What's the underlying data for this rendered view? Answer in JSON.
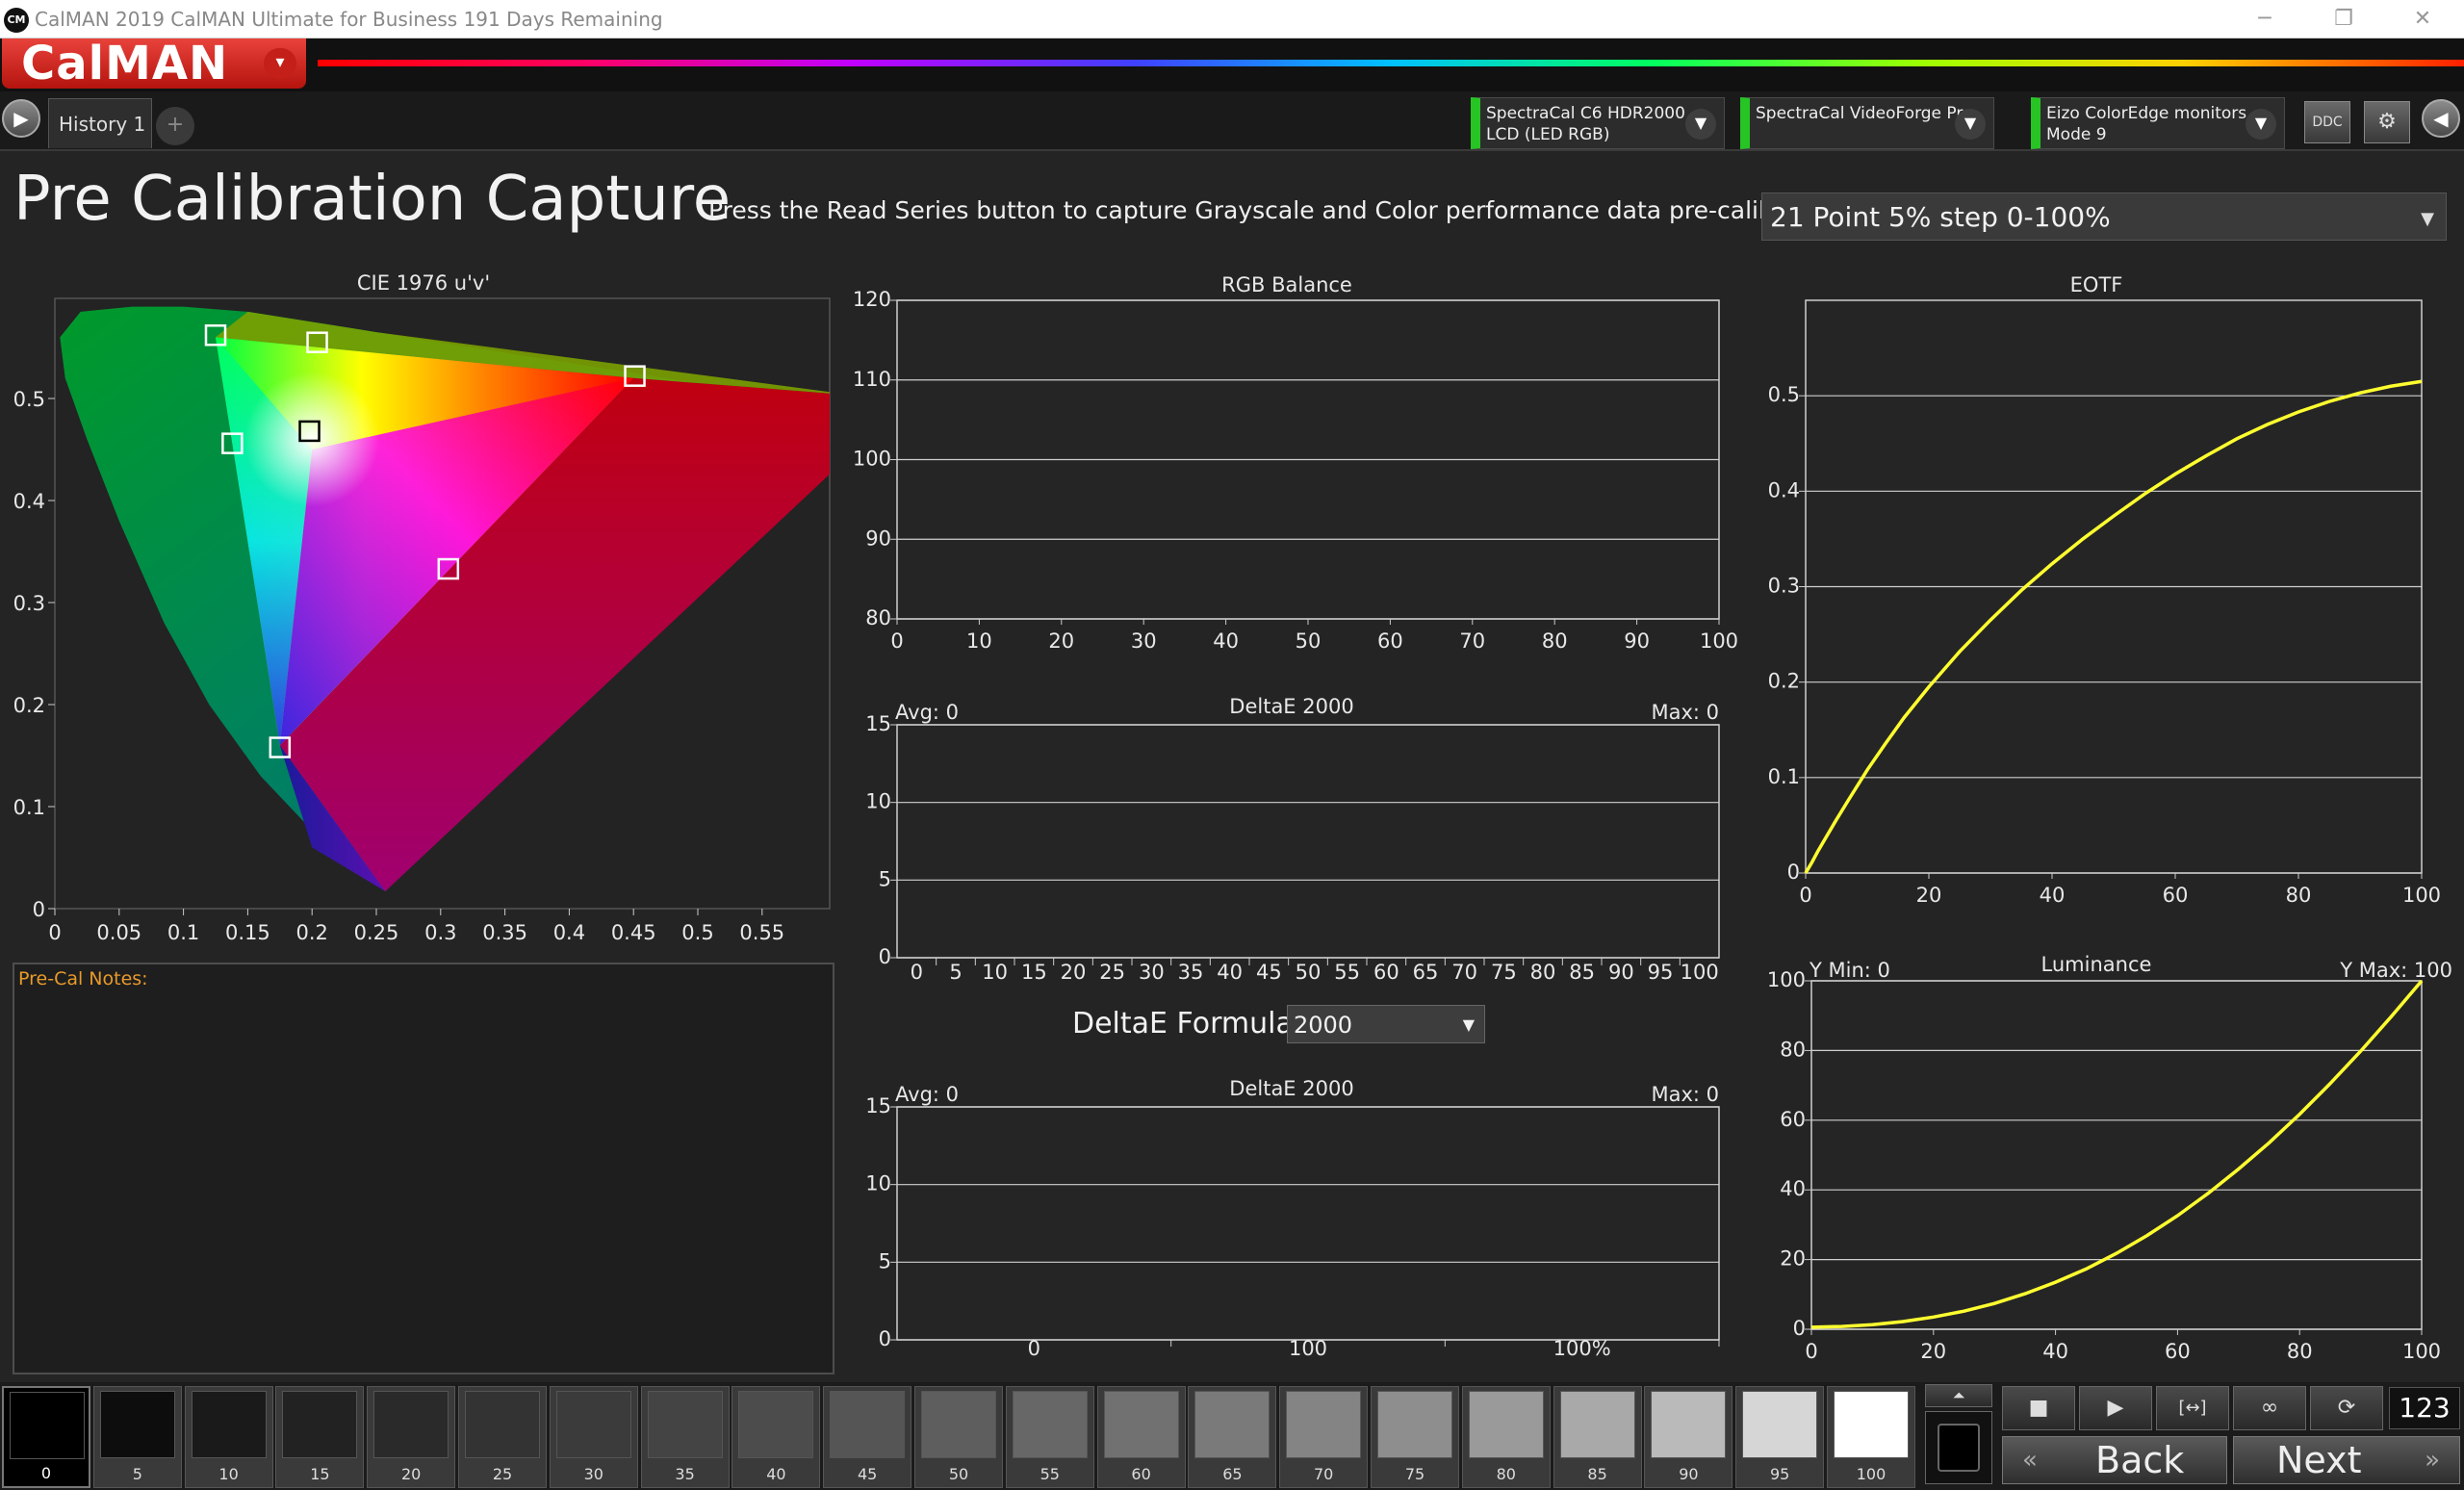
{
  "window": {
    "app_icon": "CM",
    "title": "CalMAN 2019 CalMAN Ultimate for Business 191 Days Remaining",
    "min_glyph": "─",
    "restore_glyph": "❐",
    "close_glyph": "✕"
  },
  "logo": {
    "text": "CalMAN",
    "dropdown_glyph": "▾"
  },
  "tabs": {
    "prev_glyph": "▶",
    "history_label": "History 1",
    "add_glyph": "+"
  },
  "devices": [
    {
      "line1": "SpectraCal C6 HDR2000",
      "line2": "LCD (LED RGB)",
      "status_color": "#26c524"
    },
    {
      "line1": "SpectraCal VideoForge Pro",
      "line2": "",
      "status_color": "#26c524"
    },
    {
      "line1": "Eizo ColorEdge monitors",
      "line2": "Mode 9",
      "status_color": "#26c524"
    }
  ],
  "toolbar": {
    "ddc_label": "DDC",
    "settings_icon": "gear-icon",
    "collapse_glyph": "◀"
  },
  "header": {
    "title": "Pre Calibration Capture",
    "instruction": "Press the Read Series button to capture Grayscale and Color performance data pre-calibration.",
    "series_selected": "21 Point 5% step 0-100%"
  },
  "chart_data": [
    {
      "id": "cie",
      "type": "scatter",
      "title": "CIE 1976 u'v'",
      "xlabel": "",
      "ylabel": "",
      "xlim": [
        0,
        0.6
      ],
      "ylim": [
        0,
        0.6
      ],
      "x_ticks": [
        "0",
        "0.05",
        "0.1",
        "0.15",
        "0.2",
        "0.25",
        "0.3",
        "0.35",
        "0.4",
        "0.45",
        "0.5",
        "0.55"
      ],
      "y_ticks": [
        "0",
        "0.1",
        "0.2",
        "0.3",
        "0.4",
        "0.5"
      ],
      "gamut_triangle": {
        "red": [
          0.45,
          0.52
        ],
        "green": [
          0.125,
          0.56
        ],
        "blue": [
          0.175,
          0.16
        ]
      },
      "targets": [
        {
          "name": "red",
          "u": 0.451,
          "v": 0.522,
          "color": "#ffffff"
        },
        {
          "name": "green",
          "u": 0.125,
          "v": 0.562,
          "color": "#ffffff"
        },
        {
          "name": "blue",
          "u": 0.175,
          "v": 0.158,
          "color": "#ffffff"
        },
        {
          "name": "cyan",
          "u": 0.138,
          "v": 0.456,
          "color": "#ffffff"
        },
        {
          "name": "magenta",
          "u": 0.306,
          "v": 0.333,
          "color": "#ffffff"
        },
        {
          "name": "yellow",
          "u": 0.204,
          "v": 0.555,
          "color": "#ffffff"
        },
        {
          "name": "white",
          "u": 0.198,
          "v": 0.468,
          "color": "#000000"
        }
      ]
    },
    {
      "id": "rgb_balance",
      "type": "line",
      "title": "RGB Balance",
      "xlim": [
        0,
        100
      ],
      "ylim": [
        80,
        120
      ],
      "x_ticks": [
        "0",
        "10",
        "20",
        "30",
        "40",
        "50",
        "60",
        "70",
        "80",
        "90",
        "100"
      ],
      "y_ticks": [
        "80",
        "90",
        "100",
        "110",
        "120"
      ],
      "series": []
    },
    {
      "id": "deltae_gray",
      "type": "bar",
      "title": "DeltaE 2000",
      "avg_label": "Avg: 0",
      "max_label": "Max: 0",
      "ylim": [
        0,
        15
      ],
      "categories": [
        "0",
        "5",
        "10",
        "15",
        "20",
        "25",
        "30",
        "35",
        "40",
        "45",
        "50",
        "55",
        "60",
        "65",
        "70",
        "75",
        "80",
        "85",
        "90",
        "95",
        "100"
      ],
      "y_ticks": [
        "0",
        "5",
        "10",
        "15"
      ],
      "values": []
    },
    {
      "id": "deltae_color",
      "type": "bar",
      "title": "DeltaE 2000",
      "avg_label": "Avg: 0",
      "max_label": "Max: 0",
      "ylim": [
        0,
        15
      ],
      "categories": [
        "0",
        "100",
        "100%"
      ],
      "y_ticks": [
        "0",
        "5",
        "10",
        "15"
      ],
      "values": []
    },
    {
      "id": "eotf",
      "type": "line",
      "title": "EOTF",
      "xlim": [
        0,
        100
      ],
      "ylim": [
        0,
        0.6
      ],
      "x_ticks": [
        "0",
        "20",
        "40",
        "60",
        "80",
        "100"
      ],
      "y_ticks": [
        "0",
        "0.1",
        "0.2",
        "0.3",
        "0.4",
        "0.5"
      ],
      "series": [
        {
          "color": "#ffff30",
          "x": [
            0,
            1,
            2,
            3,
            5,
            7,
            10,
            13,
            16,
            20,
            25,
            30,
            35,
            40,
            45,
            50,
            55,
            60,
            65,
            70,
            75,
            80,
            85,
            90,
            95,
            100
          ],
          "y": [
            0,
            0.011,
            0.023,
            0.034,
            0.056,
            0.077,
            0.108,
            0.136,
            0.163,
            0.195,
            0.232,
            0.265,
            0.296,
            0.324,
            0.35,
            0.374,
            0.397,
            0.418,
            0.437,
            0.455,
            0.47,
            0.483,
            0.494,
            0.503,
            0.51,
            0.515
          ]
        }
      ]
    },
    {
      "id": "luminance",
      "type": "line",
      "title": "Luminance",
      "ymin_label": "Y Min: 0",
      "ymax_label": "Y Max: 100",
      "xlim": [
        0,
        100
      ],
      "ylim": [
        0,
        100
      ],
      "x_ticks": [
        "0",
        "20",
        "40",
        "60",
        "80",
        "100"
      ],
      "y_ticks": [
        "0",
        "20",
        "40",
        "60",
        "80",
        "100"
      ],
      "series": [
        {
          "color": "#ffff30",
          "x": [
            0,
            5,
            10,
            15,
            20,
            25,
            30,
            35,
            40,
            45,
            50,
            55,
            60,
            65,
            70,
            75,
            80,
            85,
            90,
            95,
            100
          ],
          "y": [
            0.6,
            0.8,
            1.3,
            2.2,
            3.5,
            5.2,
            7.4,
            10.2,
            13.5,
            17.3,
            21.8,
            26.9,
            32.6,
            39.0,
            46.0,
            53.5,
            61.7,
            70.5,
            79.8,
            89.7,
            100
          ]
        }
      ]
    }
  ],
  "notes": {
    "label": "Pre-Cal Notes:"
  },
  "deltae_formula": {
    "label": "DeltaE Formula",
    "selected": "2000"
  },
  "swatches": [
    {
      "label": "0",
      "gray": "#000000"
    },
    {
      "label": "5",
      "gray": "#0d0d0d"
    },
    {
      "label": "10",
      "gray": "#1a1a1a"
    },
    {
      "label": "15",
      "gray": "#222222"
    },
    {
      "label": "20",
      "gray": "#2a2a2a"
    },
    {
      "label": "25",
      "gray": "#333333"
    },
    {
      "label": "30",
      "gray": "#3b3b3b"
    },
    {
      "label": "35",
      "gray": "#444444"
    },
    {
      "label": "40",
      "gray": "#4c4c4c"
    },
    {
      "label": "45",
      "gray": "#555555"
    },
    {
      "label": "50",
      "gray": "#5e5e5e"
    },
    {
      "label": "55",
      "gray": "#676767"
    },
    {
      "label": "60",
      "gray": "#717171"
    },
    {
      "label": "65",
      "gray": "#7a7a7a"
    },
    {
      "label": "70",
      "gray": "#848484"
    },
    {
      "label": "75",
      "gray": "#8e8e8e"
    },
    {
      "label": "80",
      "gray": "#9a9a9a"
    },
    {
      "label": "85",
      "gray": "#a9a9a9"
    },
    {
      "label": "90",
      "gray": "#bababa"
    },
    {
      "label": "95",
      "gray": "#d6d6d6"
    },
    {
      "label": "100",
      "gray": "#ffffff"
    }
  ],
  "controls": {
    "up_glyph": "⏶",
    "stop_glyph": "■",
    "play_glyph": "▶",
    "read_glyph": "[↔]",
    "loop_glyph": "∞",
    "refresh_glyph": "⟳",
    "counter": "123",
    "back_label": "Back",
    "next_label": "Next",
    "back_glyph": "«",
    "next_glyph": "»"
  }
}
